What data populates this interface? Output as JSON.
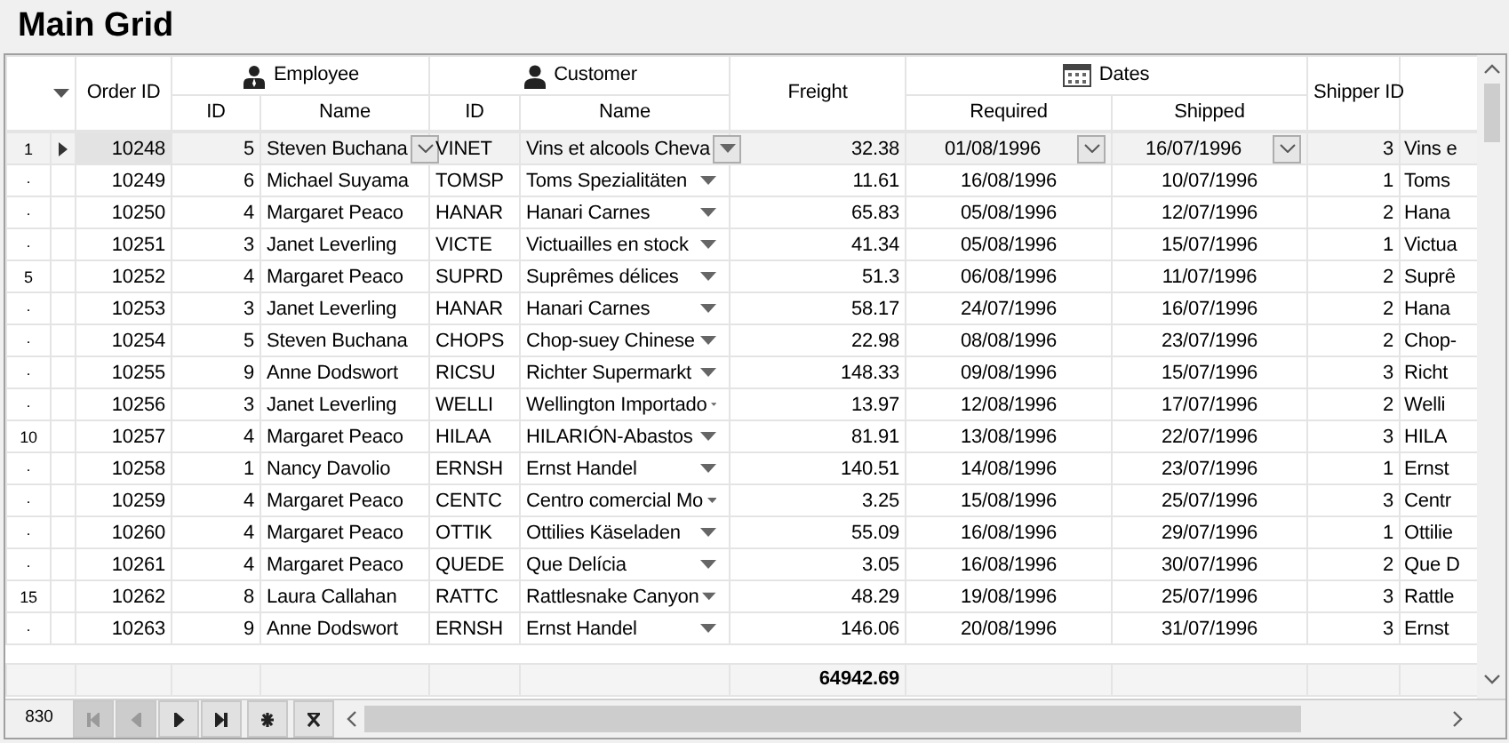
{
  "title": "Main Grid",
  "header": [
    {
      "label": "Order ID",
      "kind": "number"
    },
    {
      "label": "Employee",
      "subcolumns": [
        {
          "label": "ID",
          "kind": "number"
        },
        {
          "label": "Name",
          "kind": "lookup"
        }
      ]
    },
    {
      "label": "Customer",
      "subcolumns": [
        {
          "label": "ID",
          "kind": "text"
        },
        {
          "label": "Name",
          "kind": "combo"
        }
      ]
    },
    {
      "label": "Freight",
      "kind": "number"
    },
    {
      "label": "Dates",
      "subcolumns": [
        {
          "label": "Required",
          "kind": "date"
        },
        {
          "label": "Shipped",
          "kind": "date"
        }
      ]
    },
    {
      "label": "Shipper ID",
      "kind": "number"
    },
    {
      "kind": "text"
    }
  ],
  "rows": [
    {
      "label": "1",
      "selected": true,
      "cells": [
        "10248",
        "5",
        "Steven Buchana",
        "VINET",
        "Vins et alcools Cheva",
        "32.38",
        "01/08/1996",
        "16/07/1996",
        "3",
        "Vins e"
      ]
    },
    {
      "label": "·",
      "selected": false,
      "cells": [
        "10249",
        "6",
        "Michael Suyama",
        "TOMSP",
        "Toms Spezialitäten",
        "11.61",
        "16/08/1996",
        "10/07/1996",
        "1",
        "Toms"
      ]
    },
    {
      "label": "·",
      "selected": false,
      "cells": [
        "10250",
        "4",
        "Margaret Peaco",
        "HANAR",
        "Hanari Carnes",
        "65.83",
        "05/08/1996",
        "12/07/1996",
        "2",
        "Hana"
      ]
    },
    {
      "label": "·",
      "selected": false,
      "cells": [
        "10251",
        "3",
        "Janet Leverling",
        "VICTE",
        "Victuailles en stock",
        "41.34",
        "05/08/1996",
        "15/07/1996",
        "1",
        "Victua"
      ]
    },
    {
      "label": "5",
      "selected": false,
      "cells": [
        "10252",
        "4",
        "Margaret Peaco",
        "SUPRD",
        "Suprêmes délices",
        "51.3",
        "06/08/1996",
        "11/07/1996",
        "2",
        "Suprê"
      ]
    },
    {
      "label": "·",
      "selected": false,
      "cells": [
        "10253",
        "3",
        "Janet Leverling",
        "HANAR",
        "Hanari Carnes",
        "58.17",
        "24/07/1996",
        "16/07/1996",
        "2",
        "Hana"
      ]
    },
    {
      "label": "·",
      "selected": false,
      "cells": [
        "10254",
        "5",
        "Steven Buchana",
        "CHOPS",
        "Chop-suey Chinese",
        "22.98",
        "08/08/1996",
        "23/07/1996",
        "2",
        "Chop-"
      ]
    },
    {
      "label": "·",
      "selected": false,
      "cells": [
        "10255",
        "9",
        "Anne Dodswort",
        "RICSU",
        "Richter Supermarkt",
        "148.33",
        "09/08/1996",
        "15/07/1996",
        "3",
        "Richt"
      ]
    },
    {
      "label": "·",
      "selected": false,
      "cells": [
        "10256",
        "3",
        "Janet Leverling",
        "WELLI",
        "Wellington Importado",
        "13.97",
        "12/08/1996",
        "17/07/1996",
        "2",
        "Welli"
      ]
    },
    {
      "label": "10",
      "selected": false,
      "cells": [
        "10257",
        "4",
        "Margaret Peaco",
        "HILAA",
        "HILARIÓN-Abastos",
        "81.91",
        "13/08/1996",
        "22/07/1996",
        "3",
        "HILA"
      ]
    },
    {
      "label": "·",
      "selected": false,
      "cells": [
        "10258",
        "1",
        "Nancy Davolio",
        "ERNSH",
        "Ernst Handel",
        "140.51",
        "14/08/1996",
        "23/07/1996",
        "1",
        "Ernst"
      ]
    },
    {
      "label": "·",
      "selected": false,
      "cells": [
        "10259",
        "4",
        "Margaret Peaco",
        "CENTC",
        "Centro comercial Mo",
        "3.25",
        "15/08/1996",
        "25/07/1996",
        "3",
        "Centr"
      ]
    },
    {
      "label": "·",
      "selected": false,
      "cells": [
        "10260",
        "4",
        "Margaret Peaco",
        "OTTIK",
        "Ottilies Käseladen",
        "55.09",
        "16/08/1996",
        "29/07/1996",
        "1",
        "Ottilie"
      ]
    },
    {
      "label": "·",
      "selected": false,
      "cells": [
        "10261",
        "4",
        "Margaret Peaco",
        "QUEDE",
        "Que Delícia",
        "3.05",
        "16/08/1996",
        "30/07/1996",
        "2",
        "Que D"
      ]
    },
    {
      "label": "15",
      "selected": false,
      "cells": [
        "10262",
        "8",
        "Laura Callahan",
        "RATTC",
        "Rattlesnake Canyon",
        "48.29",
        "19/08/1996",
        "25/07/1996",
        "3",
        "Rattle"
      ]
    },
    {
      "label": "·",
      "selected": false,
      "cells": [
        "10263",
        "9",
        "Anne Dodswort",
        "ERNSH",
        "Ernst Handel",
        "146.06",
        "20/08/1996",
        "31/07/1996",
        "3",
        "Ernst"
      ]
    }
  ],
  "summary": {
    "freight_total": "64942.69"
  },
  "navigator": {
    "record_count": "830",
    "buttons": [
      {
        "kind": "first",
        "disabled": true
      },
      {
        "kind": "previous",
        "disabled": true
      },
      {
        "kind": "next",
        "disabled": false
      },
      {
        "kind": "last",
        "disabled": false
      },
      {
        "kind": "new",
        "disabled": false
      },
      {
        "kind": "delete",
        "disabled": false
      }
    ]
  }
}
